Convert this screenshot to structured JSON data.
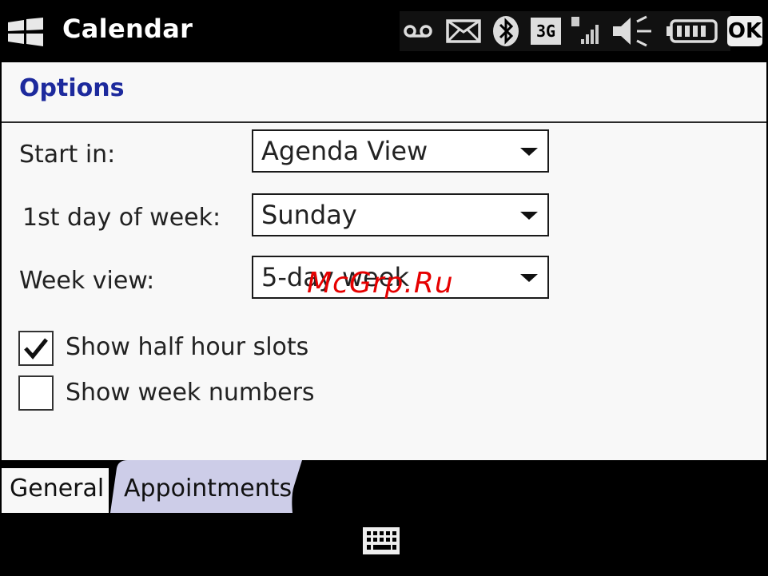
{
  "titlebar": {
    "title": "Calendar",
    "icons": [
      "windows-start-icon",
      "voicemail-icon",
      "message-icon",
      "bluetooth-icon",
      "3g-icon",
      "signal-icon",
      "volume-icon",
      "battery-icon",
      "ok-button"
    ],
    "ok_label": "OK",
    "network_label": "3G"
  },
  "header": {
    "title": "Options"
  },
  "form": {
    "start_in": {
      "label": "Start in:",
      "value": "Agenda View"
    },
    "first_day": {
      "label": "1st day of week:",
      "value": "Sunday"
    },
    "week_view": {
      "label": "Week view:",
      "value": "5-day week"
    }
  },
  "checkboxes": [
    {
      "label": "Show half hour slots",
      "checked": true
    },
    {
      "label": "Show week numbers",
      "checked": false
    }
  ],
  "watermark": "McGrp.Ru",
  "tabs": [
    {
      "label": "General",
      "active": true
    },
    {
      "label": "Appointments",
      "active": false
    }
  ],
  "bottombar": {
    "icon": "keyboard-icon"
  }
}
